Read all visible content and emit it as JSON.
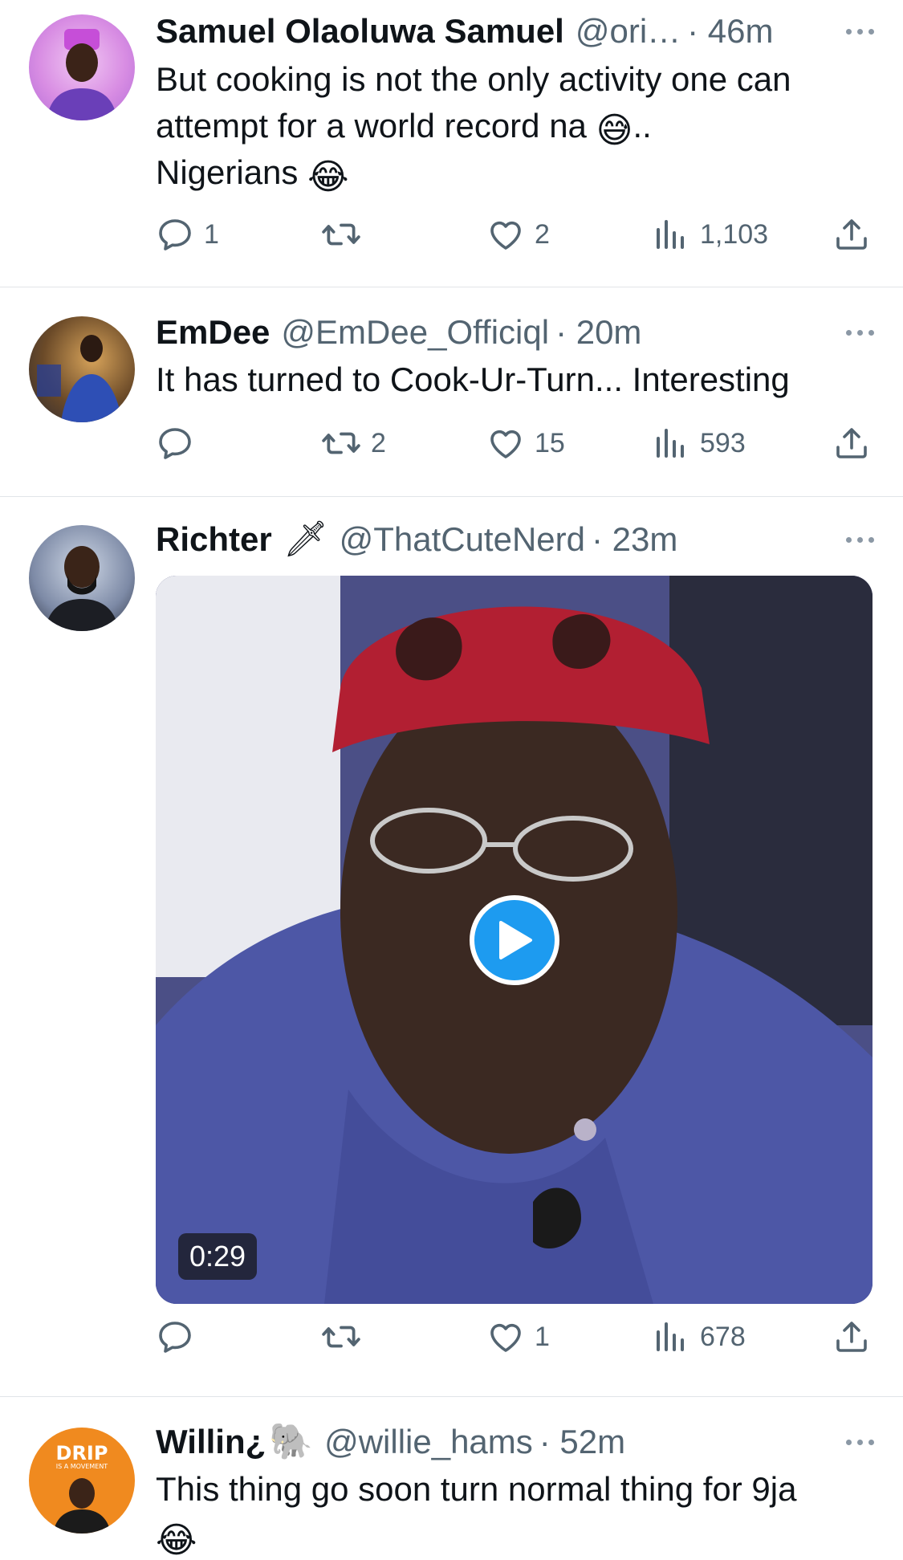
{
  "tweets": [
    {
      "name": "Samuel Olaoluwa Samuel",
      "handle": "@ori…",
      "time": "· 46m",
      "text": "But cooking is not the only activity one can attempt for a world record na",
      "emoji1": "😅",
      "text_after_emoji1": "..",
      "text2": "Nigerians",
      "emoji2": "😂",
      "replies": "1",
      "retweets": "",
      "likes": "2",
      "views": "1,103"
    },
    {
      "name": "EmDee",
      "handle": "@EmDee_Officiql",
      "time": "· 20m",
      "text": "It has turned to Cook-Ur-Turn... Interesting",
      "replies": "",
      "retweets": "2",
      "likes": "15",
      "views": "593"
    },
    {
      "name": "Richter",
      "name_emoji": "🗡",
      "handle": "@ThatCuteNerd",
      "time": "· 23m",
      "video_duration": "0:29",
      "replies": "",
      "retweets": "",
      "likes": "1",
      "views": "678"
    },
    {
      "name": "Willin¿",
      "name_emoji": "🐘",
      "handle": "@willie_hams",
      "time": "· 52m",
      "text": "This thing go soon turn normal thing for 9ja",
      "emoji": "😂",
      "avatar_text": "DRIP",
      "avatar_subtext": "IS A MOVEMENT"
    }
  ],
  "colors": {
    "text": "#0f1419",
    "secondary": "#536471",
    "divider": "#e1e4e8",
    "play": "#1d9bf0"
  },
  "icons": [
    "reply-icon",
    "retweet-icon",
    "like-icon",
    "views-icon",
    "share-icon",
    "more-icon",
    "play-icon"
  ]
}
